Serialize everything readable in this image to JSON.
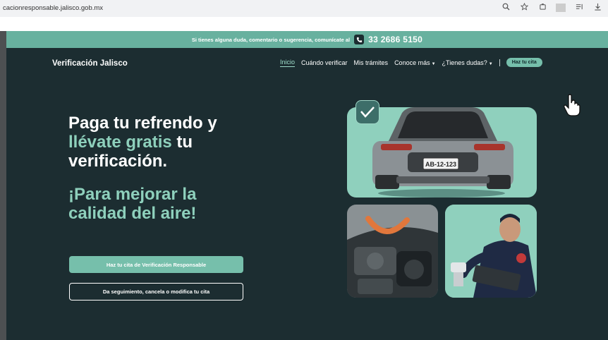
{
  "browser": {
    "url": "cacionresponsable.jalisco.gob.mx"
  },
  "promo": {
    "text": "Si tienes alguna duda, comentario o sugerencia, comunícate al",
    "phone": "33 2686 5150"
  },
  "header": {
    "brand": "Verificación Jalisco",
    "nav": [
      {
        "label": "Inicio",
        "active": true
      },
      {
        "label": "Cuándo verificar"
      },
      {
        "label": "Mis trámites"
      },
      {
        "label": "Conoce más"
      },
      {
        "label": "¿Tienes dudas?"
      }
    ],
    "cta": "Haz tu cita"
  },
  "hero": {
    "line1": "Paga tu refrendo y",
    "line2_accent": "llévate gratis",
    "line2_rest": " tu",
    "line3": "verificación.",
    "subtitle": "¡Para mejorar la calidad del aire!",
    "primary_button": "Haz tu cita de Verificación Responsable",
    "secondary_button": "Da seguimiento, cancela o modifica tu cita"
  },
  "images": {
    "plate_text": "AB-12-123"
  },
  "colors": {
    "page_bg": "#1c2d31",
    "accent": "#76bfab",
    "accent_text": "#8ed0bc",
    "promo_bg": "#68b19f"
  }
}
